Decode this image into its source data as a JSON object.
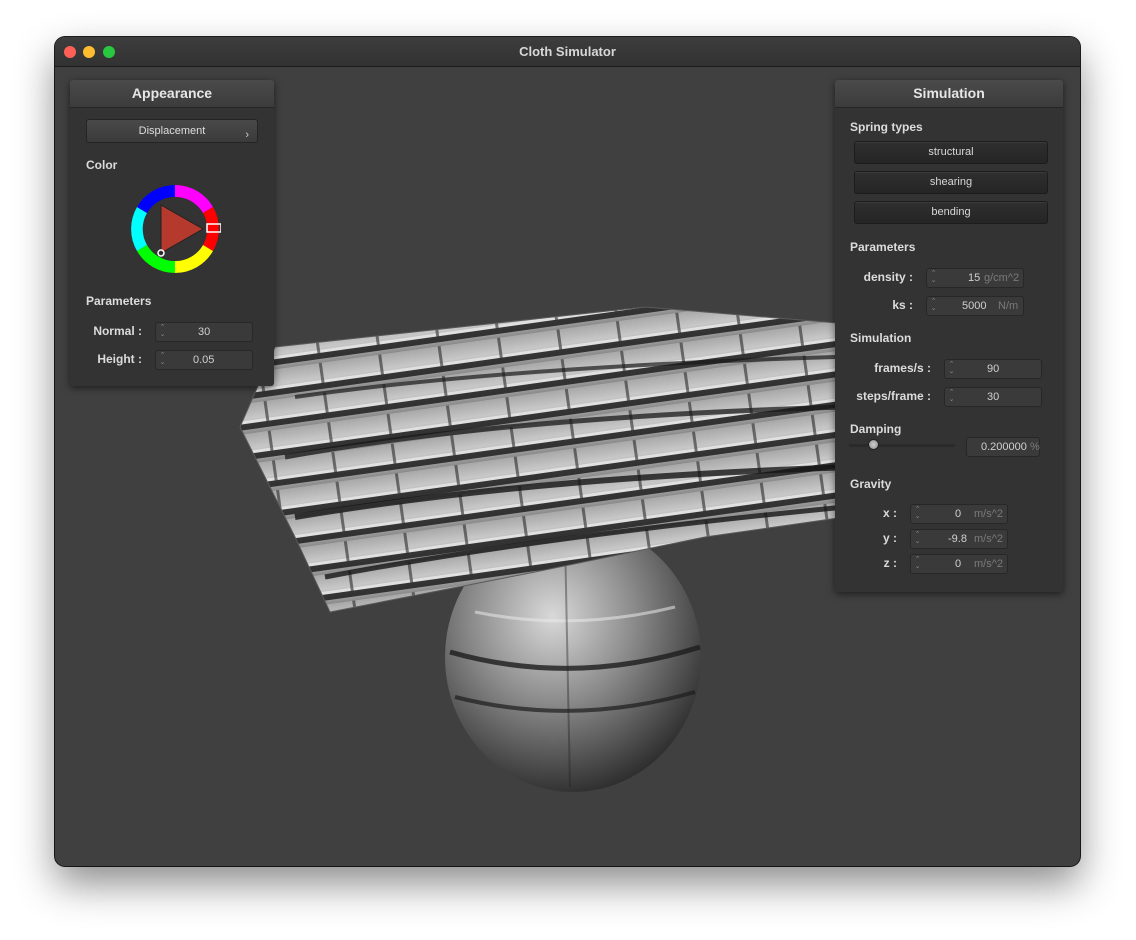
{
  "window": {
    "title": "Cloth Simulator"
  },
  "appearance": {
    "header": "Appearance",
    "shader_dropdown": "Displacement",
    "color_label": "Color",
    "selected_color": "#e02020",
    "parameters_label": "Parameters",
    "normal": {
      "label": "Normal :",
      "value": "30"
    },
    "height": {
      "label": "Height :",
      "value": "0.05"
    }
  },
  "simulation": {
    "header": "Simulation",
    "spring_types_label": "Spring types",
    "spring_buttons": [
      "structural",
      "shearing",
      "bending"
    ],
    "parameters_label": "Parameters",
    "density": {
      "label": "density :",
      "value": "15",
      "unit": "g/cm^2"
    },
    "ks": {
      "label": "ks :",
      "value": "5000",
      "unit": "N/m"
    },
    "simulation_label": "Simulation",
    "frames_per_s": {
      "label": "frames/s :",
      "value": "90"
    },
    "steps_per_frame": {
      "label": "steps/frame :",
      "value": "30"
    },
    "damping_label": "Damping",
    "damping": {
      "value": "0.200000",
      "unit": "%",
      "slider_fraction": 0.2
    },
    "gravity_label": "Gravity",
    "gravity": {
      "x": {
        "label": "x :",
        "value": "0",
        "unit": "m/s^2"
      },
      "y": {
        "label": "y :",
        "value": "-9.8",
        "unit": "m/s^2"
      },
      "z": {
        "label": "z :",
        "value": "0",
        "unit": "m/s^2"
      }
    }
  },
  "theme": {
    "window_bg": "#404040",
    "panel_bg": "#333333",
    "close": "#fe5f57",
    "minimize": "#febc2e",
    "maximize": "#28c840"
  }
}
